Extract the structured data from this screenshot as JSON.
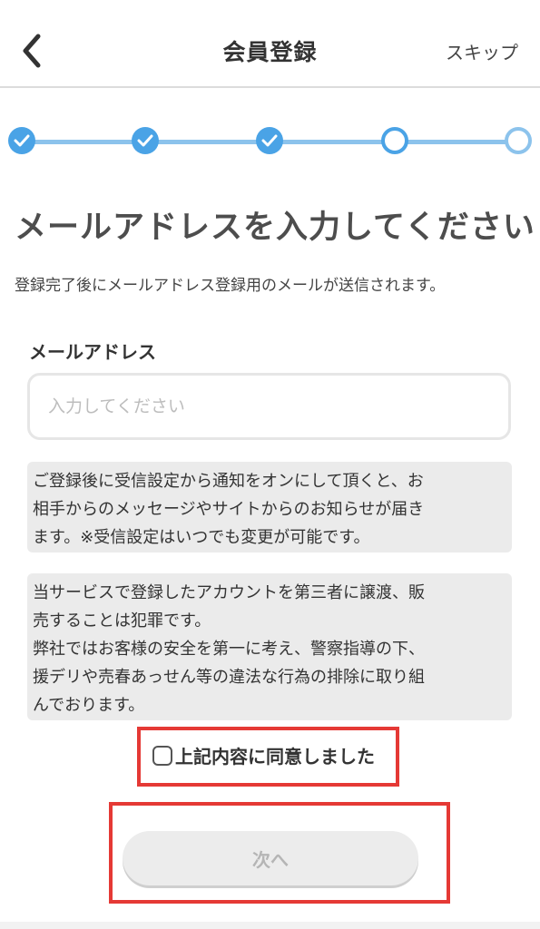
{
  "header": {
    "title": "会員登録",
    "skip_label": "スキップ",
    "back_icon": "chevron-left-icon"
  },
  "stepper": {
    "steps": [
      {
        "state": "done"
      },
      {
        "state": "done"
      },
      {
        "state": "done"
      },
      {
        "state": "current"
      },
      {
        "state": "upcoming"
      }
    ],
    "active_color": "#4aa3e6",
    "line_color": "#8cc3ec"
  },
  "main": {
    "heading": "メールアドレスを入力してください",
    "subtext": "登録完了後にメールアドレス登録用のメールが送信されます。",
    "email_label": "メールアドレス",
    "email_value": "",
    "email_placeholder": "入力してください",
    "notice1": [
      "ご登録後に受信設定から通知をオンにして頂くと、お",
      "相手からのメッセージやサイトからのお知らせが届き",
      "ます。※受信設定はいつでも変更が可能です。"
    ],
    "notice2": [
      "当サービスで登録したアカウントを第三者に譲渡、販",
      "売することは犯罪です。",
      "弊社ではお客様の安全を第一に考え、警察指導の下、",
      "援デリや売春あっせん等の違法な行為の排除に取り組",
      "んでおります。"
    ],
    "agree_label": "上記内容に同意しました",
    "agree_checked": false,
    "next_label": "次へ"
  },
  "colors": {
    "highlight_border": "#e53935",
    "notice_bg": "#ebebeb",
    "disabled_button_bg": "#ececec"
  }
}
